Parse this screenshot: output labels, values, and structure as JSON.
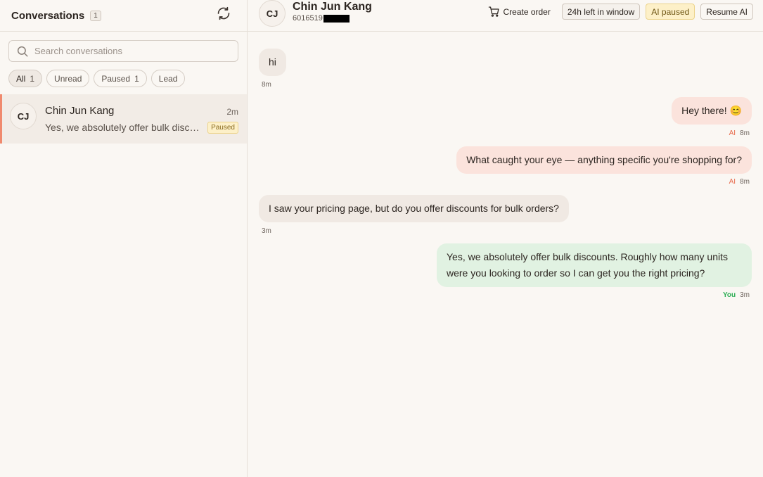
{
  "sidebar": {
    "title": "Conversations",
    "count": "1",
    "search_placeholder": "Search conversations",
    "filters": [
      {
        "label": "All",
        "count": "1"
      },
      {
        "label": "Unread",
        "count": ""
      },
      {
        "label": "Paused",
        "count": "1"
      },
      {
        "label": "Lead",
        "count": ""
      }
    ],
    "conversations": [
      {
        "initials": "CJ",
        "name": "Chin Jun Kang",
        "time": "2m",
        "preview": "Yes, we absolutely offer bulk discounts. Roughly how many units were you looking to order so I can get you the right pricing?",
        "badge": "Paused"
      }
    ]
  },
  "header": {
    "initials": "CJ",
    "name": "Chin Jun Kang",
    "phone_visible": "6016519",
    "create_order": "Create order",
    "window_label": "24h left in window",
    "ai_status": "AI paused",
    "resume_label": "Resume AI"
  },
  "messages": [
    {
      "text": "hi",
      "sender": "",
      "time": "8m"
    },
    {
      "text": "Hey there! 😊",
      "sender": "AI",
      "time": "8m"
    },
    {
      "text": "What caught your eye — anything specific you're shopping for?",
      "sender": "AI",
      "time": "8m"
    },
    {
      "text": "I saw your pricing page, but do you offer discounts for bulk orders?",
      "sender": "",
      "time": "3m"
    },
    {
      "text": "Yes, we absolutely offer bulk discounts. Roughly how many units were you looking to order so I can get you the right pricing?",
      "sender": "You",
      "time": "3m"
    }
  ],
  "colors": {
    "accent": "#f08a6e",
    "ai_bubble": "#fbe3dc",
    "you_bubble": "#e1f2e2",
    "incoming_bubble": "#f0e9e3",
    "paused_badge": "#fdf0c8"
  }
}
